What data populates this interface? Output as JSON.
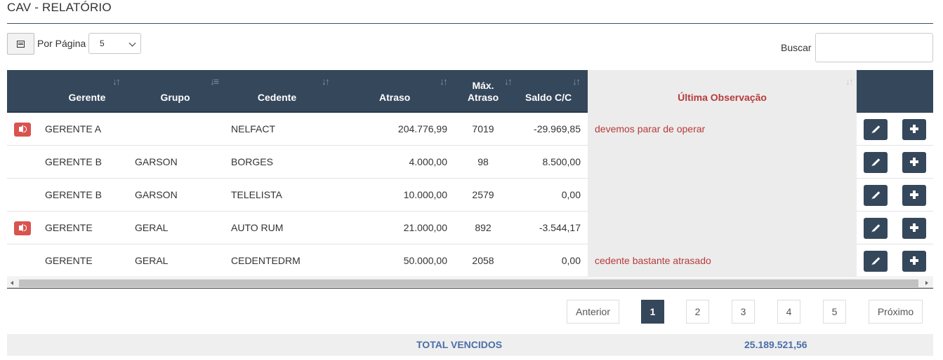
{
  "page": {
    "title": "CAV - RELATÓRIO"
  },
  "controls": {
    "per_page_label": "Por Página",
    "per_page_value": "5",
    "search_label": "Buscar",
    "search_value": ""
  },
  "table": {
    "columns": {
      "gerente": "Gerente",
      "grupo": "Grupo",
      "cedente": "Cedente",
      "atraso": "Atraso",
      "max_atraso_1": "Máx.",
      "max_atraso_2": "Atraso",
      "saldo": "Saldo C/C",
      "obs": "Última Observação"
    },
    "sort_icon": "↓↑",
    "sort_icon_active": "↓≡",
    "rows": [
      {
        "alarm": true,
        "gerente": "GERENTE A",
        "grupo": "",
        "cedente": "NELFACT",
        "atraso": "204.776,99",
        "max_atraso": "7019",
        "saldo": "-29.969,85",
        "obs": "devemos parar de operar"
      },
      {
        "alarm": false,
        "gerente": "GERENTE B",
        "grupo": "GARSON",
        "cedente": "BORGES",
        "atraso": "4.000,00",
        "max_atraso": "98",
        "saldo": "8.500,00",
        "obs": ""
      },
      {
        "alarm": false,
        "gerente": "GERENTE B",
        "grupo": "GARSON",
        "cedente": "TELELISTA",
        "atraso": "10.000,00",
        "max_atraso": "2579",
        "saldo": "0,00",
        "obs": ""
      },
      {
        "alarm": true,
        "gerente": "GERENTE",
        "grupo": "GERAL",
        "cedente": "AUTO RUM",
        "atraso": "21.000,00",
        "max_atraso": "892",
        "saldo": "-3.544,17",
        "obs": ""
      },
      {
        "alarm": false,
        "gerente": "GERENTE",
        "grupo": "GERAL",
        "cedente": "CEDENTEDRM",
        "atraso": "50.000,00",
        "max_atraso": "2058",
        "saldo": "0,00",
        "obs": "cedente bastante atrasado"
      }
    ]
  },
  "pagination": {
    "prev": "Anterior",
    "pages": [
      "1",
      "2",
      "3",
      "4",
      "5"
    ],
    "active_page": "1",
    "next": "Próximo"
  },
  "footer": {
    "label": "TOTAL VENCIDOS",
    "value": "25.189.521,56"
  },
  "colors": {
    "header_bg": "#35475b",
    "obs_text": "#b83a3a",
    "alarm": "#d9534f",
    "footer_text": "#4a6ea8"
  },
  "icons": {
    "list_button": "list-icon",
    "alarm": "volume-icon",
    "edit": "pencil-icon",
    "add": "plus-icon"
  }
}
